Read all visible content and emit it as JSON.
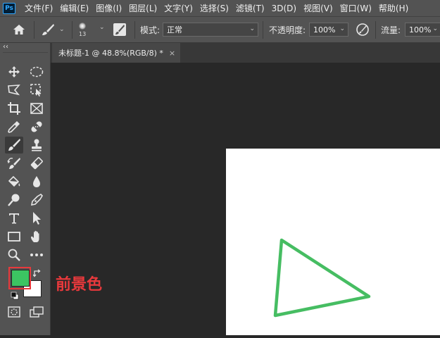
{
  "app": {
    "logo_text": "Ps"
  },
  "menu": [
    "文件(F)",
    "编辑(E)",
    "图像(I)",
    "图层(L)",
    "文字(Y)",
    "选择(S)",
    "滤镜(T)",
    "3D(D)",
    "视图(V)",
    "窗口(W)",
    "帮助(H)"
  ],
  "options": {
    "brush_size": "13",
    "mode_label": "模式:",
    "mode_value": "正常",
    "opacity_label": "不透明度:",
    "opacity_value": "100%",
    "flow_label": "流量:",
    "flow_value": "100%"
  },
  "toolbar": {
    "collapse": "‹‹"
  },
  "document": {
    "tab_title": "未标题-1 @ 48.8%(RGB/8) *",
    "close": "×"
  },
  "colors": {
    "foreground": "#3cc462",
    "background": "#ffffff",
    "stroke": "#3cb95a"
  },
  "annotation": {
    "text": "前景色"
  }
}
